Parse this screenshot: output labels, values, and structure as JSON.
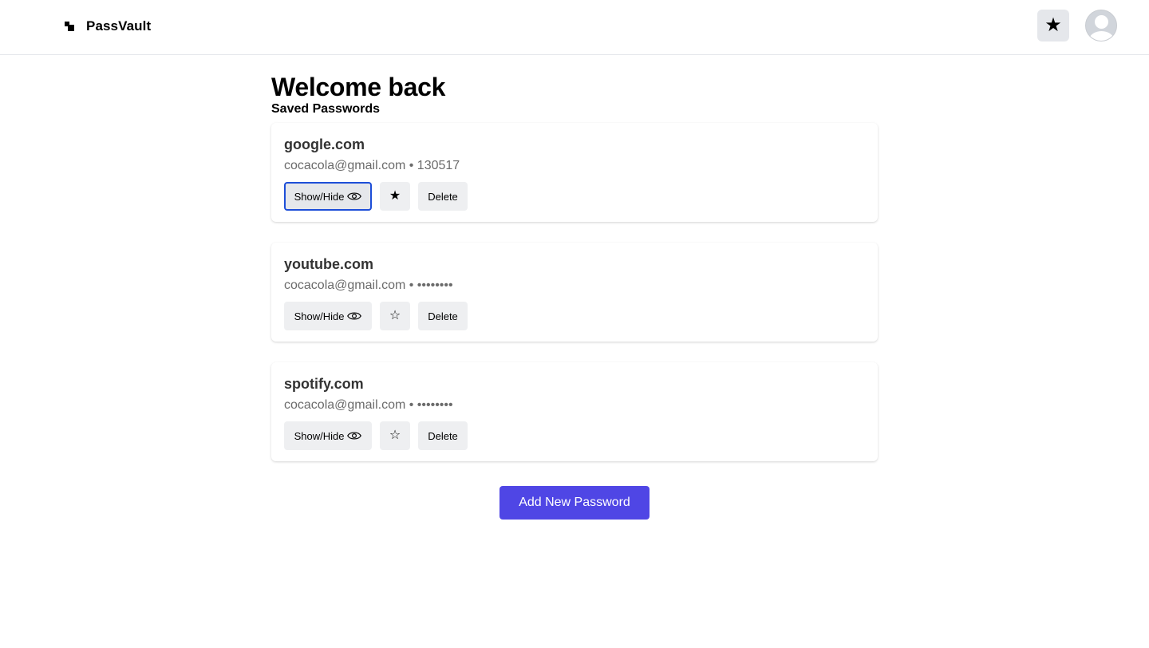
{
  "header": {
    "brand_name": "PassVault",
    "favorites_icon": "★"
  },
  "main": {
    "title": "Welcome back",
    "subtitle": "Saved Passwords",
    "entries": [
      {
        "site": "google.com",
        "credentials": "cocacola@gmail.com • 130517",
        "show_hide_label": "Show/Hide",
        "star_icon": "★",
        "delete_label": "Delete"
      },
      {
        "site": "youtube.com",
        "credentials": "cocacola@gmail.com • ••••••••",
        "show_hide_label": "Show/Hide",
        "star_icon": "☆",
        "delete_label": "Delete"
      },
      {
        "site": "spotify.com",
        "credentials": "cocacola@gmail.com • ••••••••",
        "show_hide_label": "Show/Hide",
        "star_icon": "☆",
        "delete_label": "Delete"
      }
    ],
    "add_button_label": "Add New Password"
  },
  "colors": {
    "accent": "#4f46e5",
    "focus_ring": "#1d4ed8"
  }
}
